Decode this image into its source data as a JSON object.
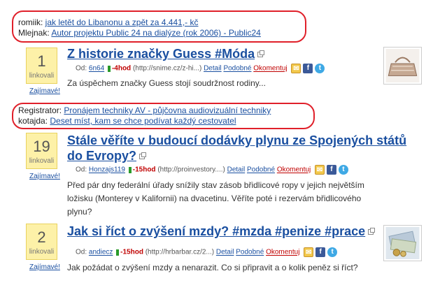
{
  "box1": {
    "row1": {
      "label": "romiik: ",
      "link": "jak letět do Libanonu a zpět za 4.441,- kč"
    },
    "row2": {
      "label": "Mlejnak: ",
      "link": "Autor projektu Public 24 na dialýze (rok 2006) - Public24"
    }
  },
  "box2": {
    "row1": {
      "label": "Registrator: ",
      "link": "Pronájem techniky AV - půjčovna audiovizuální techniky"
    },
    "row2": {
      "label": "kotajda: ",
      "link": "Deset míst, kam se chce podívat každý cestovatel"
    }
  },
  "score_label": "linkovali",
  "zajimave": "Zajímavé!",
  "articles": [
    {
      "score": "1",
      "title": "Z historie značky Guess #Móda",
      "author_prefix": "Od: ",
      "author": "6n64",
      "ago": "-4hod",
      "source": "(http://snime.cz/z-hi...)",
      "detail": "Detail",
      "similar": "Podobné",
      "comment": "Okomentuj",
      "description": "Za úspěchem značky Guess stojí soudržnost rodiny..."
    },
    {
      "score": "19",
      "title": "Stále věříte v budoucí dodávky plynu ze Spojených států do Evropy?",
      "author_prefix": "Od: ",
      "author": "Honzajs119",
      "ago": "-15hod",
      "source": "(http://proinvestory....)",
      "detail": "Detail",
      "similar": "Podobné",
      "comment": "Okomentuj",
      "description": "Před pár dny federální úřady snížily stav zásob břidlicové ropy v jejich největším ložisku (Monterey v Kalifornii) na dvacetinu. Věříte poté i rezervám břidlicového plynu?"
    },
    {
      "score": "2",
      "title": "Jak si říct o zvýšení mzdy? #mzda #penize #prace",
      "author_prefix": "Od: ",
      "author": "andiecz",
      "ago": "-15hod",
      "source": "(http://hrbarbar.cz/2...)",
      "detail": "Detail",
      "similar": "Podobné",
      "comment": "Okomentuj",
      "description": "Jak požádat o zvýšení mzdy a nenarazit. Co si připravit a o kolik peněz si říct?"
    }
  ],
  "icons": {
    "mail": "mail-icon",
    "facebook": "facebook-icon",
    "twitter": "twitter-icon"
  },
  "colors": {
    "link": "#1a4fa0",
    "highlight": "#e0202a",
    "score_bg": "#fdf1a8",
    "time": "#c00000"
  }
}
